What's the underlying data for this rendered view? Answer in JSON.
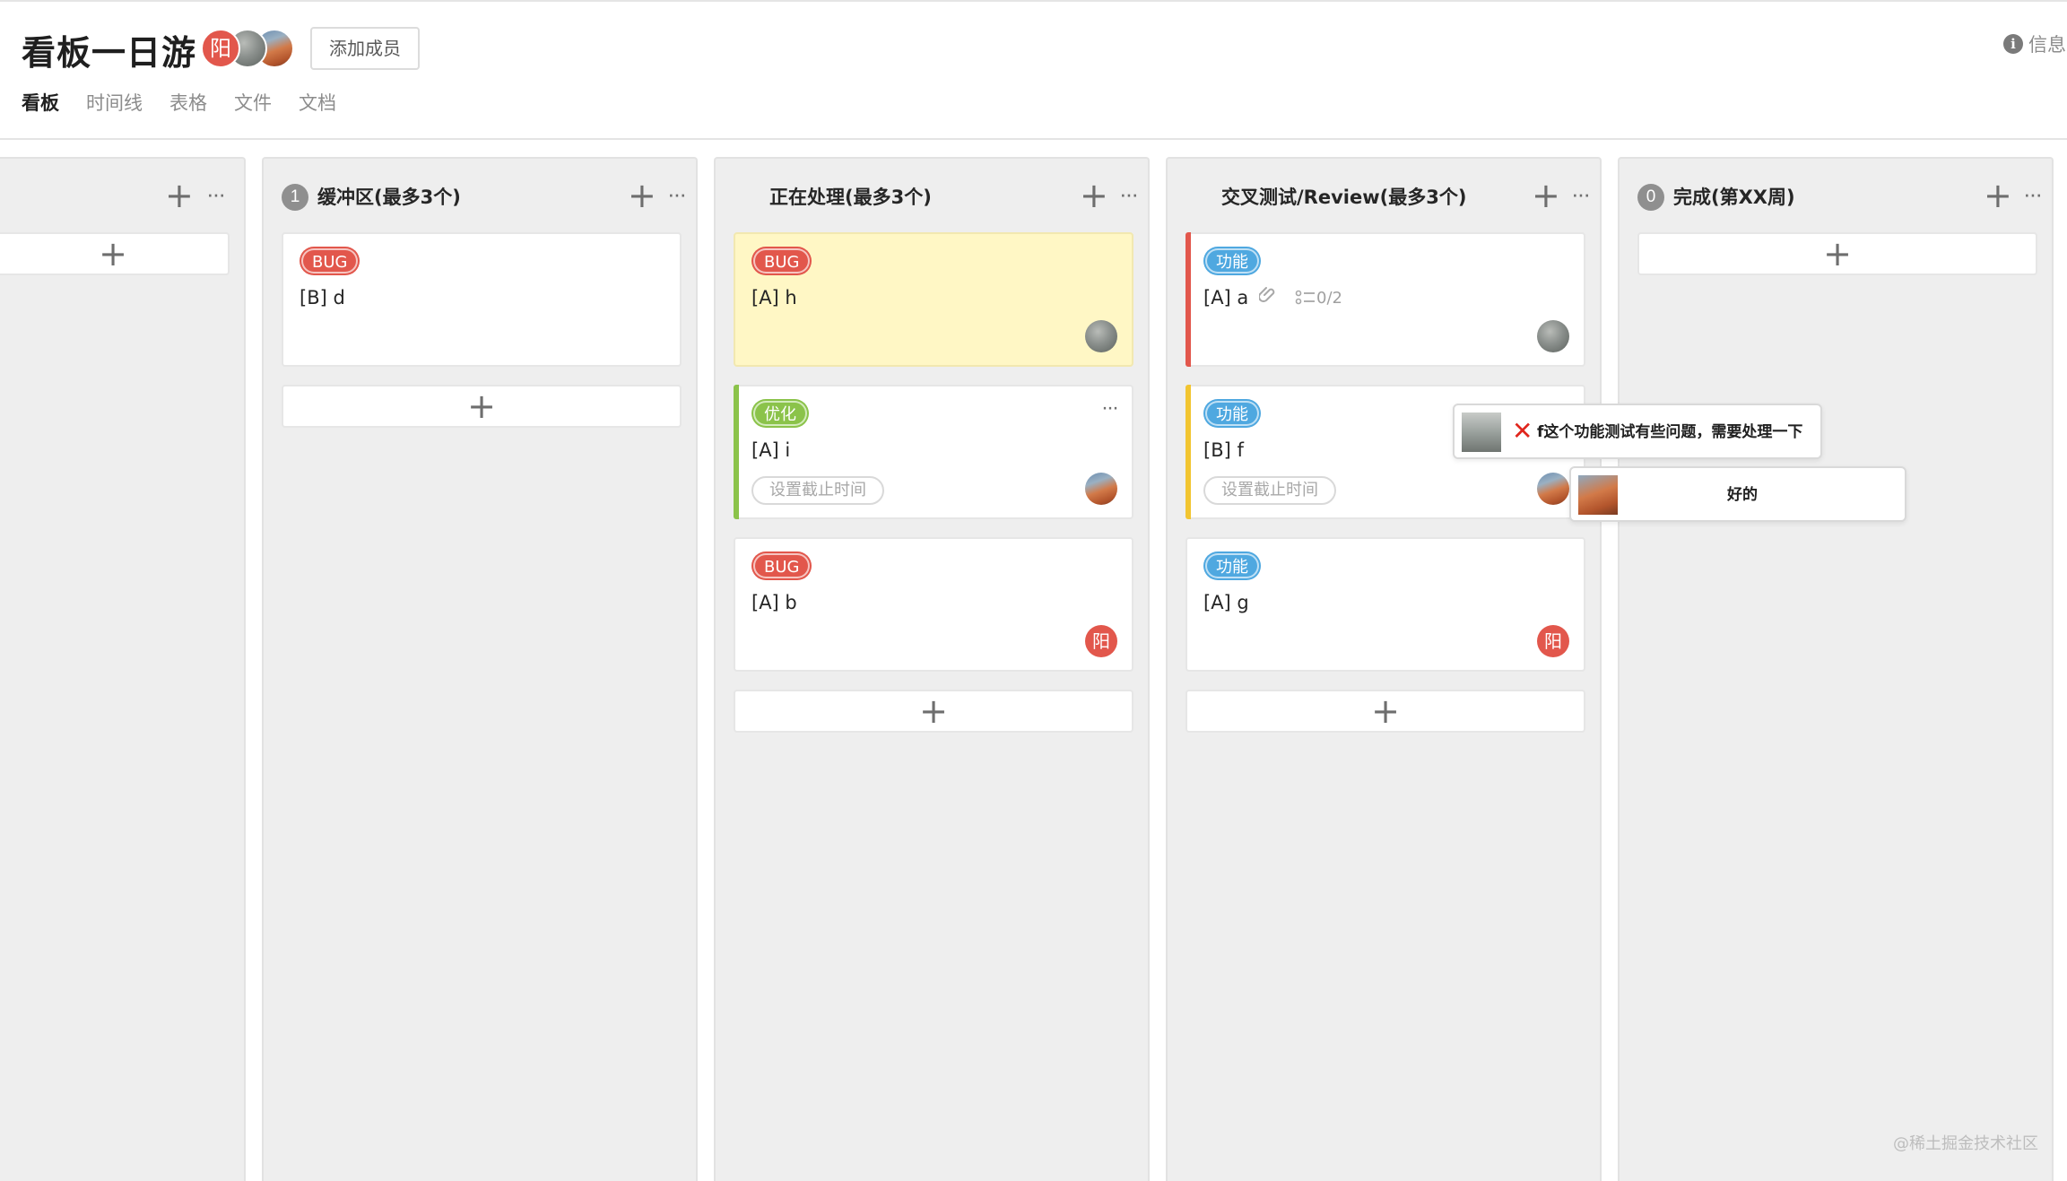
{
  "header": {
    "title": "看板一日游",
    "member_initial": "阳",
    "add_member_label": "添加成员",
    "info_label": "信息",
    "tabs": [
      {
        "label": "看板",
        "active": true
      },
      {
        "label": "时间线",
        "active": false
      },
      {
        "label": "表格",
        "active": false
      },
      {
        "label": "文件",
        "active": false
      },
      {
        "label": "文档",
        "active": false
      }
    ]
  },
  "columns": [
    {
      "title": "",
      "count": ""
    },
    {
      "title": "缓冲区(最多3个)",
      "count": "1"
    },
    {
      "title": "正在处理(最多3个)",
      "count": ""
    },
    {
      "title": "交叉测试/Review(最多3个)",
      "count": ""
    },
    {
      "title": "完成(第XX周)",
      "count": "0"
    }
  ],
  "cards": {
    "buffer_d": {
      "tag": "BUG",
      "title": "[B] d"
    },
    "doing_h": {
      "tag": "BUG",
      "title": "[A] h"
    },
    "doing_i": {
      "tag": "优化",
      "title": "[A] i",
      "due": "设置截止时间"
    },
    "doing_b": {
      "tag": "BUG",
      "title": "[A] b",
      "assignee": "阳"
    },
    "review_a": {
      "tag": "功能",
      "title": "[A] a",
      "checklist": "0/2"
    },
    "review_f": {
      "tag": "功能",
      "title": "[B] f",
      "due": "设置截止时间"
    },
    "review_g": {
      "tag": "功能",
      "title": "[A] g",
      "assignee": "阳"
    }
  },
  "comments": [
    {
      "text": "f这个功能测试有些问题，需要处理一下",
      "status_icon": "close-icon"
    },
    {
      "text": "好的"
    }
  ],
  "watermark": "@稀土掘金技术社区",
  "colors": {
    "bug": "#e2574c",
    "optimize": "#8bc34a",
    "feature": "#4fa8e0",
    "highlight_card": "#fff7c5",
    "strip_red": "#e2574c",
    "strip_green": "#8bc34a",
    "strip_yellow": "#f2c531"
  }
}
